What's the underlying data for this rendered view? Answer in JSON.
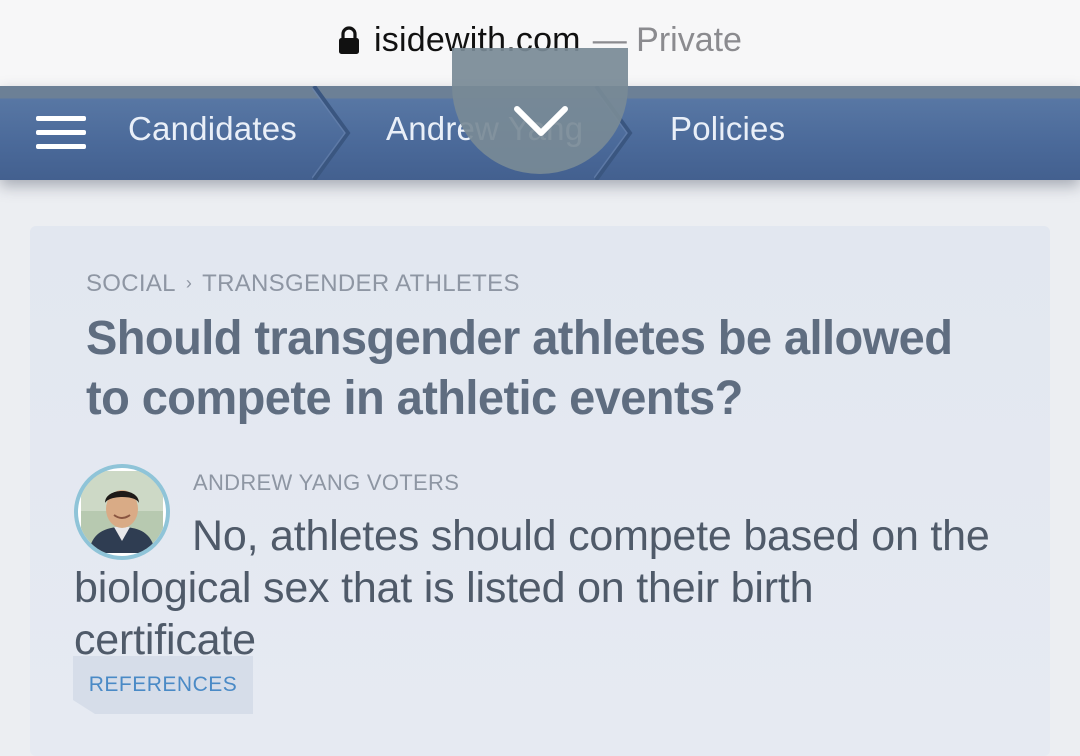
{
  "browser": {
    "domain": "isidewith.com",
    "private_label": "— Private"
  },
  "nav": {
    "items": [
      {
        "label": "Candidates"
      },
      {
        "label": "Andrew Yang"
      },
      {
        "label": "Policies"
      }
    ]
  },
  "card": {
    "breadcrumb": {
      "category": "SOCIAL",
      "separator": "›",
      "topic": "TRANSGENDER ATHLETES"
    },
    "question": "Should transgender athletes be allowed to compete in athletic events?",
    "voter_group": "ANDREW YANG VOTERS",
    "answer": "No, athletes should compete based on the biological sex that is listed on their birth certificate",
    "references_label": "REFERENCES"
  },
  "colors": {
    "nav_bg": "#4a6999",
    "title_text": "#5f6d80",
    "avatar_ring": "#8fc4d8",
    "references_text": "#4a8ac6"
  }
}
